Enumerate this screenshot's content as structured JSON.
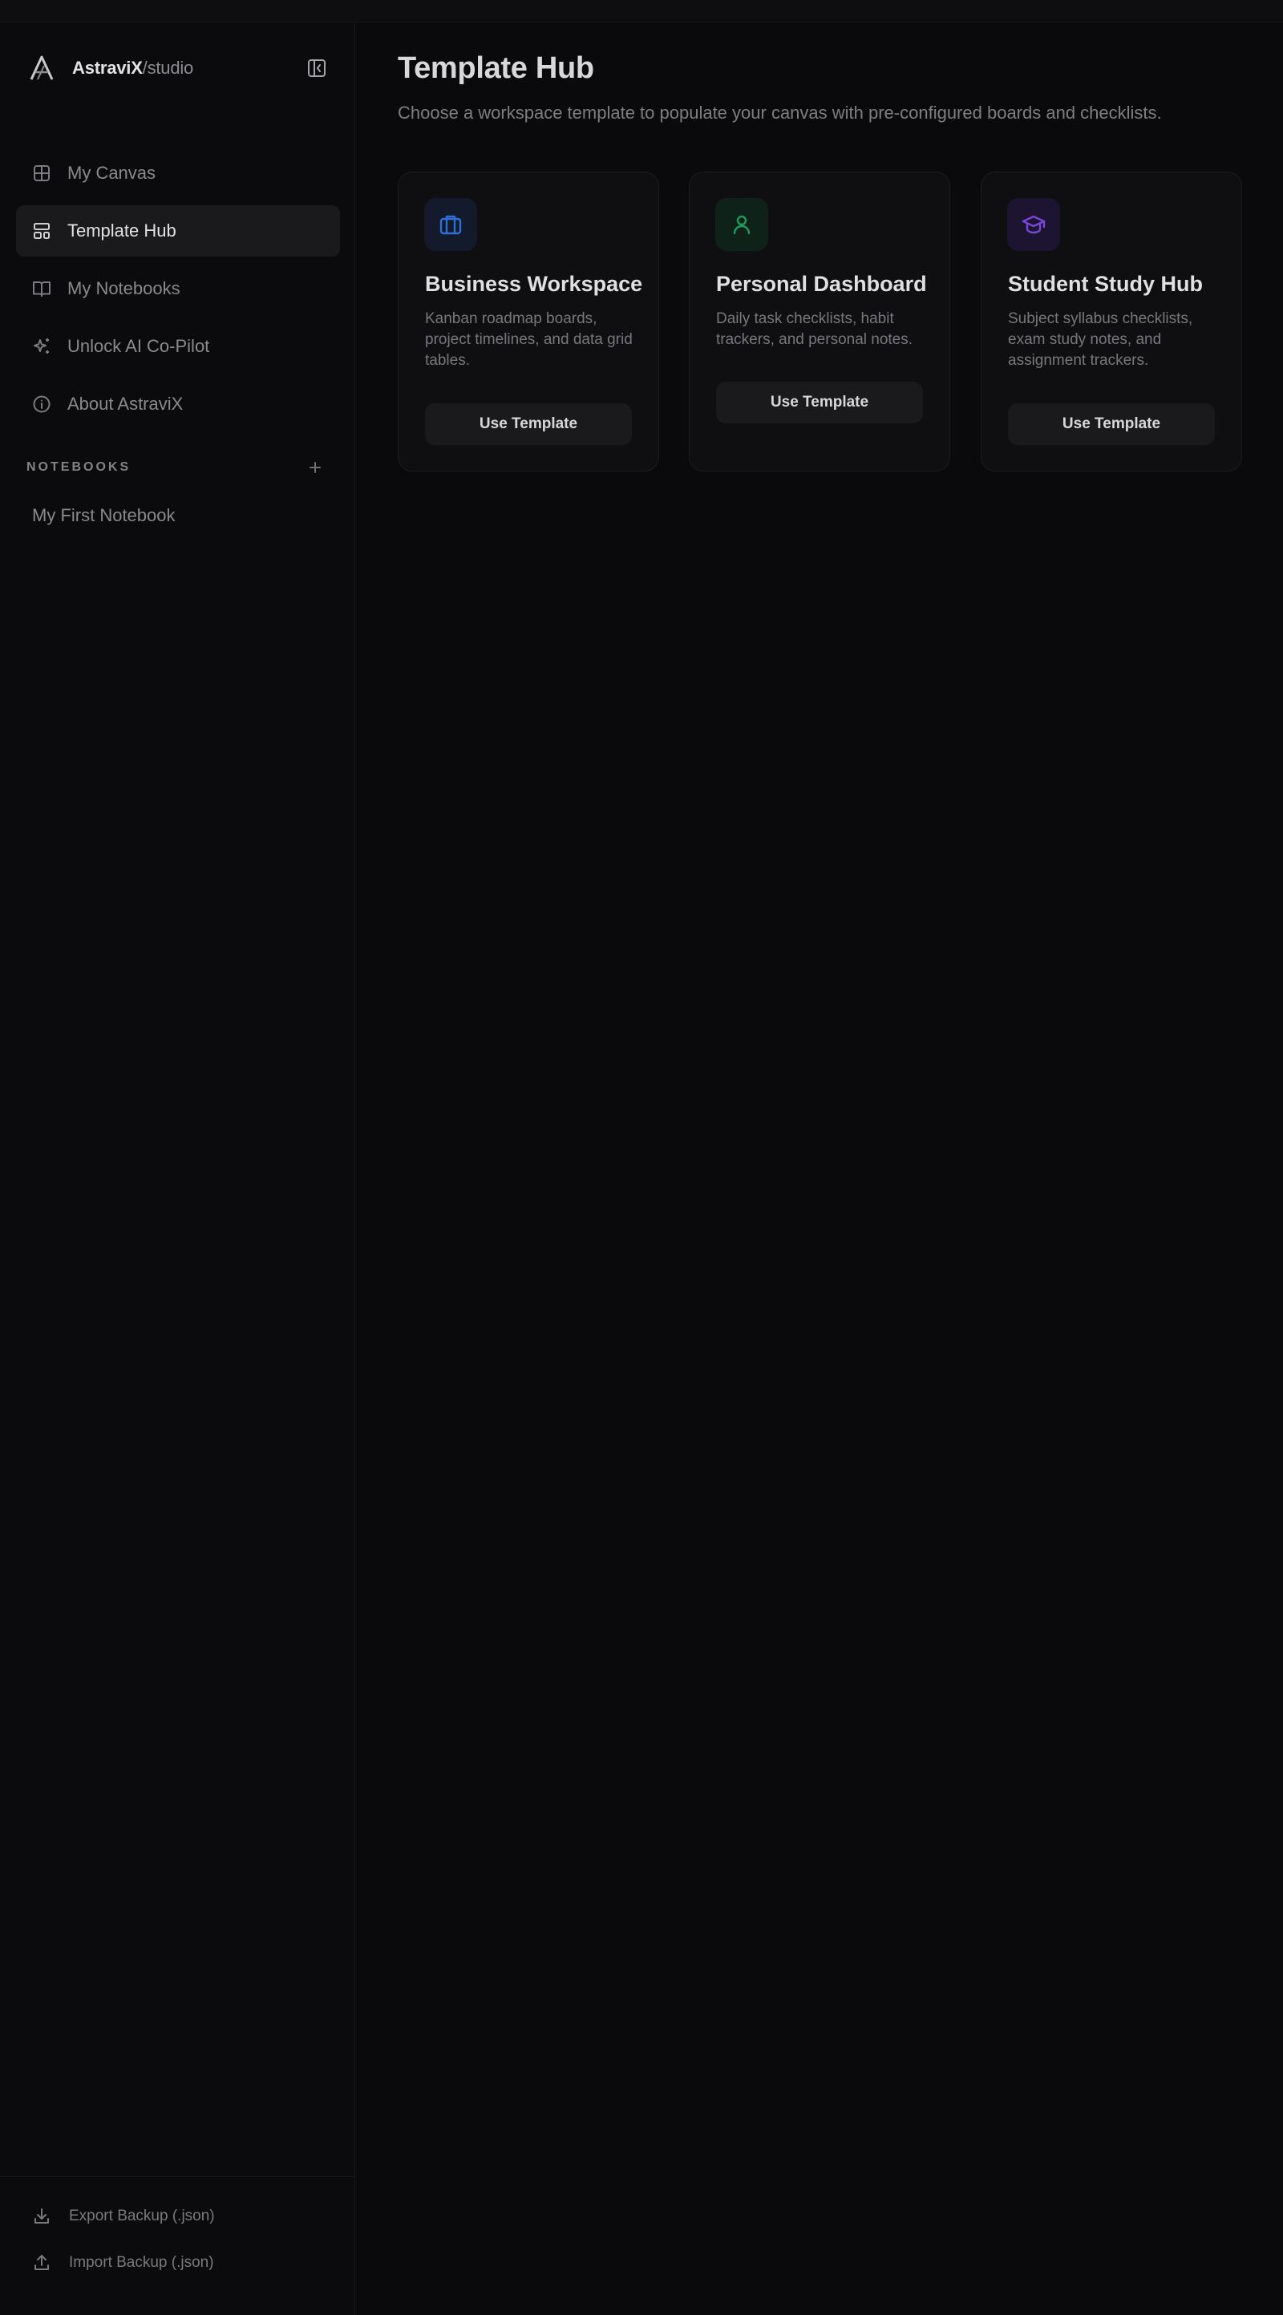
{
  "brand": {
    "name": "AstraviX",
    "suffix": "/studio"
  },
  "sidebar": {
    "items": [
      {
        "label": "My Canvas",
        "icon": "grid-icon",
        "active": false
      },
      {
        "label": "Template Hub",
        "icon": "layout-template-icon",
        "active": true
      },
      {
        "label": "My Notebooks",
        "icon": "book-open-icon",
        "active": false
      },
      {
        "label": "Unlock AI Co-Pilot",
        "icon": "sparkles-icon",
        "active": false
      },
      {
        "label": "About AstraviX",
        "icon": "info-icon",
        "active": false
      }
    ],
    "notebooks_title": "NOTEBOOKS",
    "notebooks": [
      {
        "label": "My First Notebook"
      }
    ],
    "footer": {
      "export_label": "Export Backup (.json)",
      "import_label": "Import Backup (.json)"
    }
  },
  "main": {
    "title": "Template Hub",
    "subtitle": "Choose a workspace template to populate your canvas with pre-configured boards and checklists.",
    "cards": [
      {
        "title": "Business Workspace",
        "description": "Kanban roadmap boards, project timelines, and data grid tables.",
        "button": "Use Template",
        "icon": "briefcase-icon",
        "accent": "#2f6fd6",
        "icon_bg": "#121a2b"
      },
      {
        "title": "Personal Dashboard",
        "description": "Daily task checklists, habit trackers, and personal notes.",
        "button": "Use Template",
        "icon": "user-icon",
        "accent": "#1f9a5b",
        "icon_bg": "#0f2219"
      },
      {
        "title": "Student Study Hub",
        "description": "Subject syllabus checklists, exam study notes, and assignment trackers.",
        "button": "Use Template",
        "icon": "graduation-cap-icon",
        "accent": "#7a45d8",
        "icon_bg": "#1c1430"
      }
    ]
  }
}
